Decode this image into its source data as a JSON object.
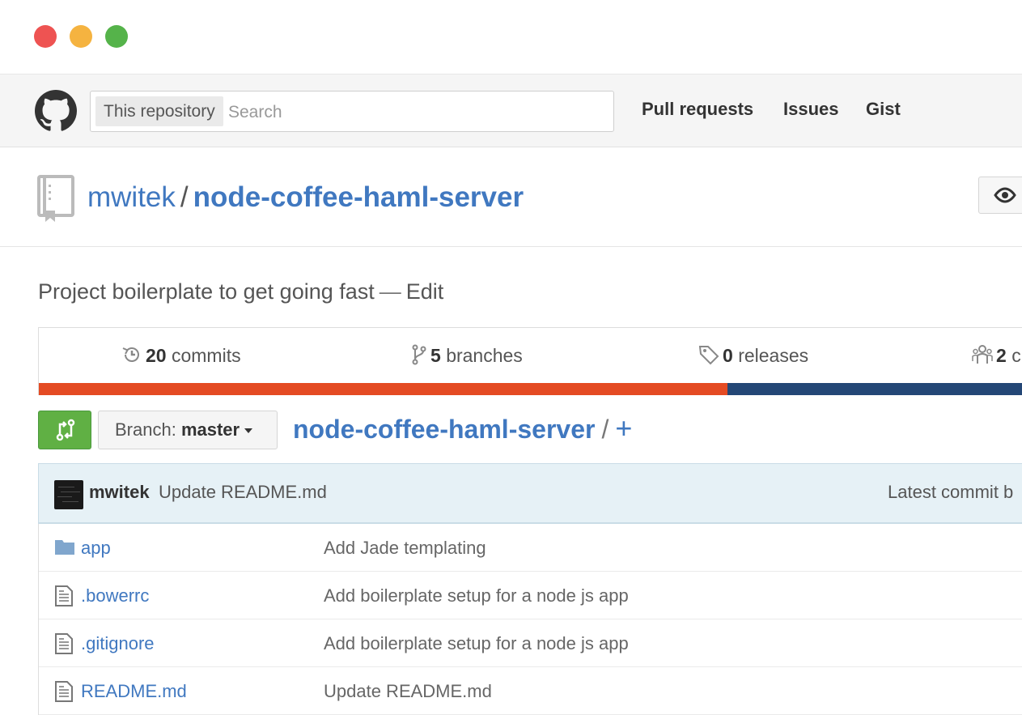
{
  "window": {
    "controls": [
      "close",
      "minimize",
      "maximize"
    ],
    "colors": {
      "close": "#ee5352",
      "minimize": "#f5b340",
      "maximize": "#55b34a"
    }
  },
  "header": {
    "logo": "github-octocat-icon",
    "search": {
      "scope": "This repository",
      "placeholder": "Search",
      "value": ""
    },
    "nav": [
      "Pull requests",
      "Issues",
      "Gist"
    ]
  },
  "repo": {
    "owner": "mwitek",
    "separator": "/",
    "name": "node-coffee-haml-server",
    "watch_icon": "eye-icon"
  },
  "description": {
    "text": "Project boilerplate to get going fast",
    "separator": "—",
    "edit": "Edit"
  },
  "summary": {
    "commits": {
      "count": "20",
      "label": "commits"
    },
    "branches": {
      "count": "5",
      "label": "branches"
    },
    "releases": {
      "count": "0",
      "label": "releases"
    },
    "contributors": {
      "count": "2",
      "label": "c"
    },
    "languages": [
      {
        "color": "#e44b23",
        "share": 0.686
      },
      {
        "color": "#244776",
        "share": 0.314
      }
    ]
  },
  "file_nav": {
    "branch_label": "Branch:",
    "branch_name": "master",
    "path_root": "node-coffee-haml-server",
    "path_sep": "/",
    "add": "+"
  },
  "commit": {
    "author": "mwitek",
    "message": "Update README.md",
    "latest_label": "Latest commit b"
  },
  "files": [
    {
      "type": "folder",
      "icon": "folder-icon",
      "name": "app",
      "message": "Add Jade templating"
    },
    {
      "type": "file",
      "icon": "file-icon",
      "name": ".bowerrc",
      "message": "Add boilerplate setup for a node js app"
    },
    {
      "type": "file",
      "icon": "file-icon",
      "name": ".gitignore",
      "message": "Add boilerplate setup for a node js app"
    },
    {
      "type": "file",
      "icon": "file-icon",
      "name": "README.md",
      "message": "Update README.md"
    }
  ]
}
